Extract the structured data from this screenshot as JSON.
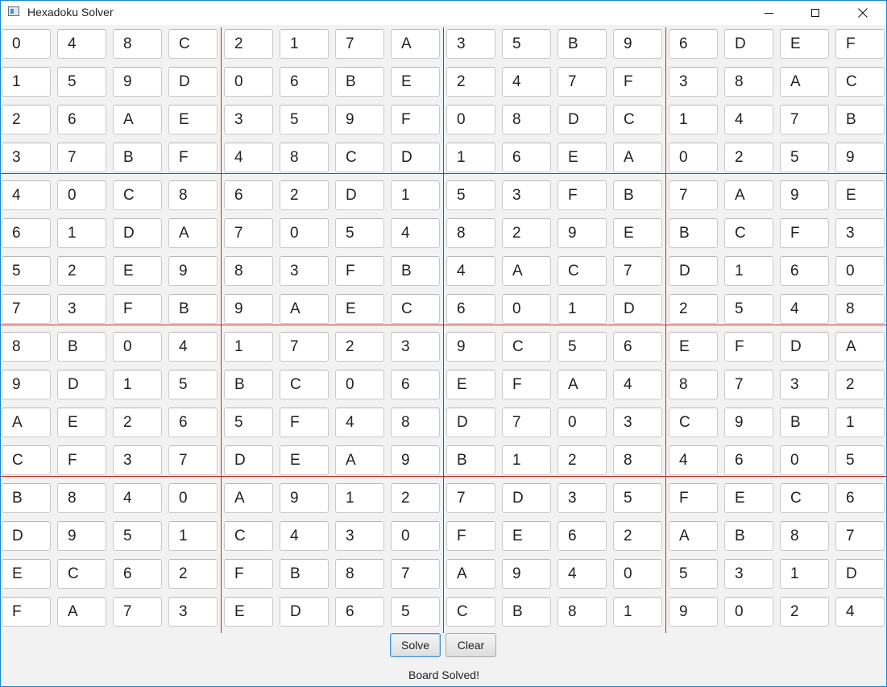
{
  "window": {
    "title": "Hexadoku Solver"
  },
  "board": {
    "rows": [
      [
        "0",
        "4",
        "8",
        "C",
        "2",
        "1",
        "7",
        "A",
        "3",
        "5",
        "B",
        "9",
        "6",
        "D",
        "E",
        "F"
      ],
      [
        "1",
        "5",
        "9",
        "D",
        "0",
        "6",
        "B",
        "E",
        "2",
        "4",
        "7",
        "F",
        "3",
        "8",
        "A",
        "C"
      ],
      [
        "2",
        "6",
        "A",
        "E",
        "3",
        "5",
        "9",
        "F",
        "0",
        "8",
        "D",
        "C",
        "1",
        "4",
        "7",
        "B"
      ],
      [
        "3",
        "7",
        "B",
        "F",
        "4",
        "8",
        "C",
        "D",
        "1",
        "6",
        "E",
        "A",
        "0",
        "2",
        "5",
        "9"
      ],
      [
        "4",
        "0",
        "C",
        "8",
        "6",
        "2",
        "D",
        "1",
        "5",
        "3",
        "F",
        "B",
        "7",
        "A",
        "9",
        "E"
      ],
      [
        "6",
        "1",
        "D",
        "A",
        "7",
        "0",
        "5",
        "4",
        "8",
        "2",
        "9",
        "E",
        "B",
        "C",
        "F",
        "3"
      ],
      [
        "5",
        "2",
        "E",
        "9",
        "8",
        "3",
        "F",
        "B",
        "4",
        "A",
        "C",
        "7",
        "D",
        "1",
        "6",
        "0"
      ],
      [
        "7",
        "3",
        "F",
        "B",
        "9",
        "A",
        "E",
        "C",
        "6",
        "0",
        "1",
        "D",
        "2",
        "5",
        "4",
        "8"
      ],
      [
        "8",
        "B",
        "0",
        "4",
        "1",
        "7",
        "2",
        "3",
        "9",
        "C",
        "5",
        "6",
        "E",
        "F",
        "D",
        "A"
      ],
      [
        "9",
        "D",
        "1",
        "5",
        "B",
        "C",
        "0",
        "6",
        "E",
        "F",
        "A",
        "4",
        "8",
        "7",
        "3",
        "2"
      ],
      [
        "A",
        "E",
        "2",
        "6",
        "5",
        "F",
        "4",
        "8",
        "D",
        "7",
        "0",
        "3",
        "C",
        "9",
        "B",
        "1"
      ],
      [
        "C",
        "F",
        "3",
        "7",
        "D",
        "E",
        "A",
        "9",
        "B",
        "1",
        "2",
        "8",
        "4",
        "6",
        "0",
        "5"
      ],
      [
        "B",
        "8",
        "4",
        "0",
        "A",
        "9",
        "1",
        "2",
        "7",
        "D",
        "3",
        "5",
        "F",
        "E",
        "C",
        "6"
      ],
      [
        "D",
        "9",
        "5",
        "1",
        "C",
        "4",
        "3",
        "0",
        "F",
        "E",
        "6",
        "2",
        "A",
        "B",
        "8",
        "7"
      ],
      [
        "E",
        "C",
        "6",
        "2",
        "F",
        "B",
        "8",
        "7",
        "A",
        "9",
        "4",
        "0",
        "5",
        "3",
        "1",
        "D"
      ],
      [
        "F",
        "A",
        "7",
        "3",
        "E",
        "D",
        "6",
        "5",
        "C",
        "B",
        "8",
        "1",
        "9",
        "0",
        "2",
        "4"
      ]
    ],
    "separator_color": "#c8281e"
  },
  "controls": {
    "solve_label": "Solve",
    "clear_label": "Clear"
  },
  "status": {
    "text": "Board  Solved!"
  },
  "icons": {
    "app": "app-window-icon",
    "minimize": "minimize-icon",
    "maximize": "maximize-icon",
    "close": "close-icon"
  }
}
